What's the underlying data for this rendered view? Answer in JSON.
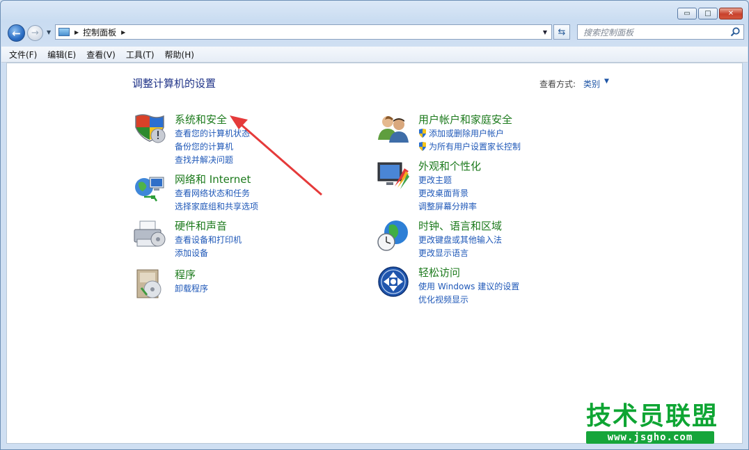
{
  "window": {
    "controls": {
      "minimize": "▭",
      "maximize": "□",
      "close": "✕"
    }
  },
  "address": {
    "path": [
      "控制面板"
    ],
    "search_placeholder": "搜索控制面板"
  },
  "menu": [
    "文件(F)",
    "编辑(E)",
    "查看(V)",
    "工具(T)",
    "帮助(H)"
  ],
  "main": {
    "title": "调整计算机的设置",
    "view_by_label": "查看方式:",
    "view_by_value": "类别"
  },
  "categories": [
    {
      "title": "系统和安全",
      "icon": "shield-icon",
      "links": [
        "查看您的计算机状态",
        "备份您的计算机",
        "查找并解决问题"
      ]
    },
    {
      "title": "网络和 Internet",
      "icon": "network-icon",
      "links": [
        "查看网络状态和任务",
        "选择家庭组和共享选项"
      ]
    },
    {
      "title": "硬件和声音",
      "icon": "printer-icon",
      "links": [
        "查看设备和打印机",
        "添加设备"
      ]
    },
    {
      "title": "程序",
      "icon": "programs-icon",
      "links": [
        "卸载程序"
      ]
    },
    {
      "title": "用户帐户和家庭安全",
      "icon": "users-icon",
      "links": [
        "添加或删除用户帐户",
        "为所有用户设置家长控制"
      ]
    },
    {
      "title": "外观和个性化",
      "icon": "appearance-icon",
      "links": [
        "更改主题",
        "更改桌面背景",
        "调整屏幕分辨率"
      ]
    },
    {
      "title": "时钟、语言和区域",
      "icon": "clock-globe-icon",
      "links": [
        "更改键盘或其他输入法",
        "更改显示语言"
      ]
    },
    {
      "title": "轻松访问",
      "icon": "ease-of-access-icon",
      "links": [
        "使用 Windows 建议的设置",
        "优化视频显示"
      ]
    }
  ],
  "watermark": {
    "text": "技术员联盟",
    "url": "www.jsgho.com"
  },
  "colors": {
    "category_title": "#1c7a1c",
    "link": "#1f58b8",
    "annotation_arrow": "#e53a3a"
  }
}
